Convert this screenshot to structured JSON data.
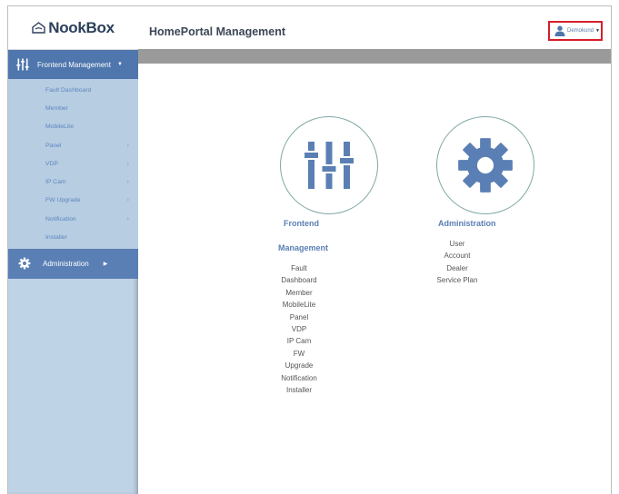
{
  "brand": {
    "name": "NookBox"
  },
  "header": {
    "title": "HomePortal Management",
    "user": "Demokund"
  },
  "sidebar": {
    "frontend_label": "Frontend Management",
    "items": [
      {
        "label": "Fault Dashboard",
        "submenu": false
      },
      {
        "label": "Member",
        "submenu": false
      },
      {
        "label": "MobileLite",
        "submenu": false
      },
      {
        "label": "Panel",
        "submenu": true
      },
      {
        "label": "VDP",
        "submenu": true
      },
      {
        "label": "IP Cam",
        "submenu": true
      },
      {
        "label": "FW Upgrade",
        "submenu": true
      },
      {
        "label": "Notification",
        "submenu": true
      },
      {
        "label": "Installer",
        "submenu": false
      }
    ],
    "admin_label": "Administration"
  },
  "frontend": {
    "title1": "Frontend",
    "title2": "Management",
    "links": [
      "Fault",
      "Dashboard",
      "Member",
      "MobileLite",
      "Panel",
      "VDP",
      "IP Cam",
      "FW",
      "Upgrade",
      "Notification",
      "Installer"
    ]
  },
  "admin": {
    "title": "Administration",
    "links": [
      "User",
      "Account",
      "Dealer",
      "Service Plan"
    ]
  },
  "colors": {
    "accent": "#4f76ad",
    "sidebar_bg": "#bfd3e6",
    "icon": "#5a7fb4",
    "highlight_border": "#d61e2b"
  }
}
